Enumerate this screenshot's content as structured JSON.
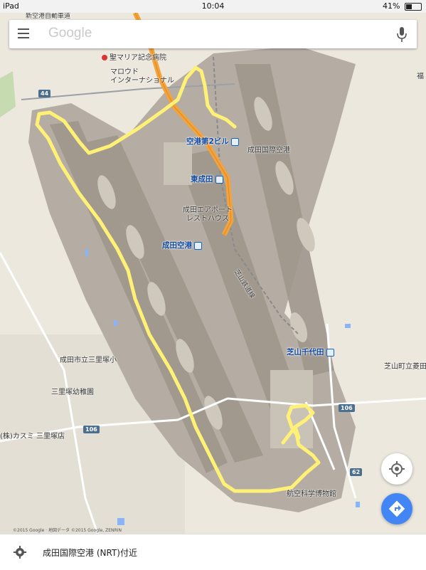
{
  "status_bar": {
    "device": "iPad",
    "time": "10:04",
    "battery": "41%",
    "battery_level": 0.41
  },
  "search": {
    "placeholder": "Google"
  },
  "map": {
    "labels": {
      "shinkuko_expressway": "新空港自動車道",
      "st_marys": "聖マリア記念病院",
      "marroad": "マロウド\nインターナショナル",
      "airport_t2_station": "空港第2ビル",
      "narita_airport_label": "成田国際空港",
      "higashi_narita": "東成田",
      "rest_house": "成田エアポート\nレストハウス",
      "narita_airport_station": "成田空港",
      "shibayama_railway": "芝山鉄道線",
      "shibayama_chiyoda": "芝山千代田",
      "shibayama_school": "芝山町立菱田",
      "misato_elem": "成田市立三里塚小",
      "misato_kinder": "三里塚幼稚園",
      "kasumi": "(株)カスミ 三里塚店",
      "aviation_museum": "航空科学博物館",
      "fuku": "福"
    },
    "route_shields": {
      "r44": "44",
      "r106_left": "106",
      "r106_right": "106",
      "r62": "62"
    },
    "copyright": "©2015 Google · 地図データ ©2015 Google, ZENRIN"
  },
  "bottom_bar": {
    "place_name": "成田国際空港 (NRT)付近"
  },
  "colors": {
    "land": "#ece8de",
    "airport": "#b5ada3",
    "expressway": "#f3a33b",
    "drawn_path": "#fff176",
    "station_text": "#0d47a1",
    "fab_blue": "#4285f4"
  }
}
